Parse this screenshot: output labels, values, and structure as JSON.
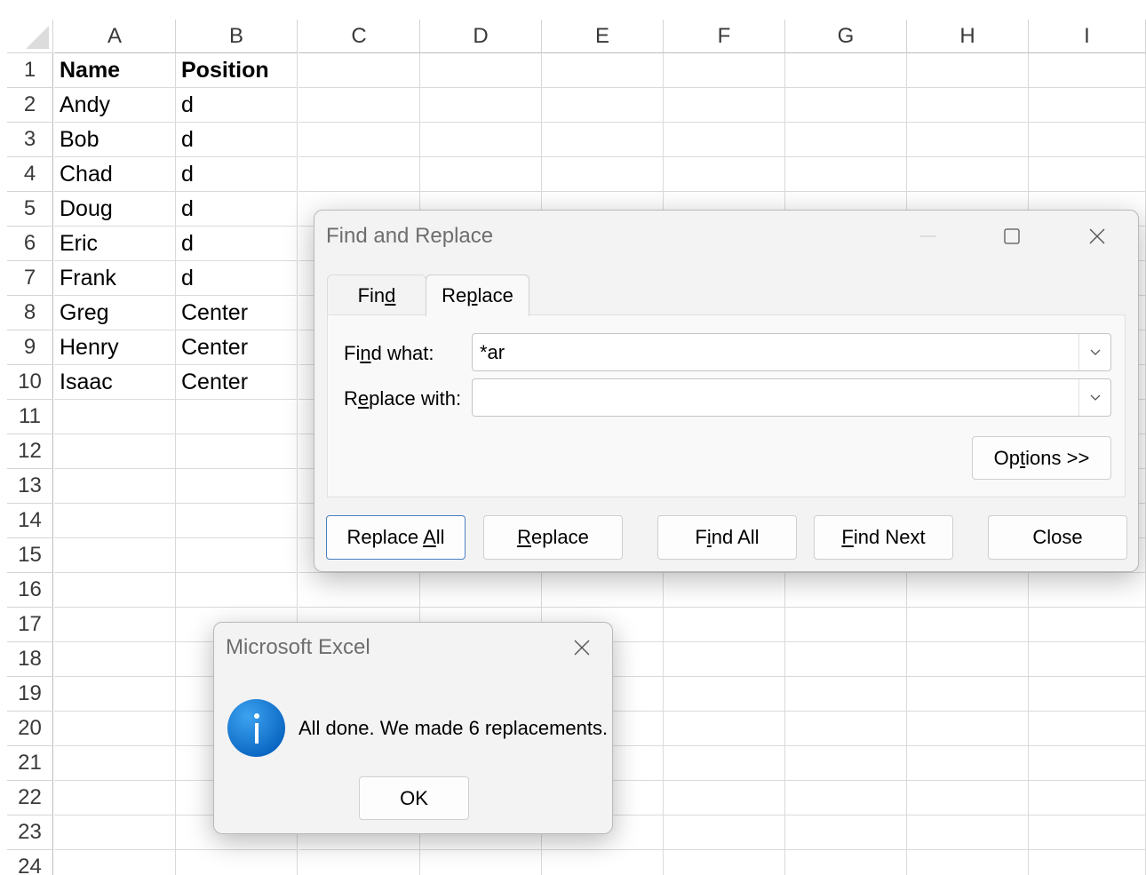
{
  "sheet": {
    "columns": [
      "A",
      "B",
      "C",
      "D",
      "E",
      "F",
      "G",
      "H",
      "I"
    ],
    "rows": [
      "1",
      "2",
      "3",
      "4",
      "5",
      "6",
      "7",
      "8",
      "9",
      "10",
      "11",
      "12",
      "13",
      "14",
      "15",
      "16",
      "17",
      "18",
      "19",
      "20",
      "21",
      "22",
      "23",
      "24"
    ],
    "cells": [
      [
        "Name",
        "Position"
      ],
      [
        "Andy",
        "d"
      ],
      [
        "Bob",
        "d"
      ],
      [
        "Chad",
        "d"
      ],
      [
        "Doug",
        "d"
      ],
      [
        "Eric",
        "d"
      ],
      [
        "Frank",
        "d"
      ],
      [
        "Greg",
        "Center"
      ],
      [
        "Henry",
        "Center"
      ],
      [
        "Isaac",
        "Center"
      ]
    ]
  },
  "find_dialog": {
    "title": "Find and Replace",
    "tabs": [
      {
        "label_pre": "Fin",
        "label_key": "d",
        "label_post": ""
      },
      {
        "label_pre": "Re",
        "label_key": "p",
        "label_post": "lace"
      }
    ],
    "active_tab": "Replace",
    "find_what": {
      "label_pre": "Fi",
      "label_key": "n",
      "label_post": "d what:",
      "value": "*ar"
    },
    "replace_with": {
      "label_pre": "R",
      "label_key": "e",
      "label_post": "place with:",
      "value": ""
    },
    "options_btn": {
      "pre": "Op",
      "key": "t",
      "post": "ions >>"
    },
    "buttons": {
      "replace_all": {
        "pre": "Replace ",
        "key": "A",
        "post": "ll"
      },
      "replace": {
        "pre": "",
        "key": "R",
        "post": "eplace"
      },
      "find_all": {
        "pre": "F",
        "key": "i",
        "post": "nd All"
      },
      "find_next": {
        "pre": "",
        "key": "F",
        "post": "ind Next"
      },
      "close": "Close"
    }
  },
  "message_box": {
    "title": "Microsoft Excel",
    "icon": "info-icon",
    "message": "All done. We made 6 replacements.",
    "ok_label": "OK"
  },
  "colors": {
    "accent_border": "#4a7fc1",
    "info_icon": "#0a66c2"
  }
}
